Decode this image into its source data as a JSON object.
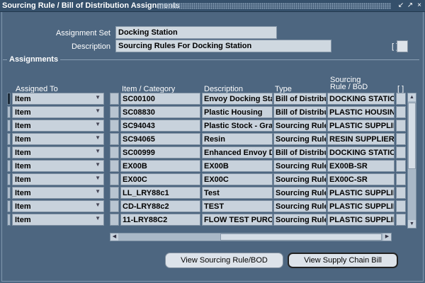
{
  "window": {
    "title": "Sourcing Rule / Bill of Distribution Assignments",
    "controls": [
      "↙",
      "↗",
      "×"
    ]
  },
  "header": {
    "assignment_set_label": "Assignment Set",
    "assignment_set_value": "Docking Station",
    "description_label": "Description",
    "description_value": "Sourcing Rules For Docking Station",
    "bracket": "[ ]"
  },
  "assignments": {
    "section_title": "Assignments",
    "columns": {
      "assigned_to": "Assigned To",
      "item_category": "Item / Category",
      "description": "Description",
      "type": "Type",
      "sourcing_rule_line1": "Sourcing",
      "sourcing_rule_line2": "Rule / BoD",
      "bracket": "[ ]"
    },
    "rows": [
      {
        "assigned_to": "Item",
        "item": "SC00100",
        "description": "Envoy Docking Station",
        "type": "Bill of Distribution",
        "rule": "DOCKING STATION"
      },
      {
        "assigned_to": "Item",
        "item": "SC08830",
        "description": "Plastic Housing",
        "type": "Bill of Distribution",
        "rule": "PLASTIC HOUSING"
      },
      {
        "assigned_to": "Item",
        "item": "SC94043",
        "description": "Plastic Stock - Gray",
        "type": "Sourcing Rule",
        "rule": "PLASTIC SUPPLIER"
      },
      {
        "assigned_to": "Item",
        "item": "SC94065",
        "description": "Resin",
        "type": "Sourcing Rule",
        "rule": "RESIN SUPPLIERS"
      },
      {
        "assigned_to": "Item",
        "item": "SC00999",
        "description": "Enhanced Envoy Docking",
        "type": "Bill of Distribution",
        "rule": "DOCKING STATION"
      },
      {
        "assigned_to": "Item",
        "item": "EX00B",
        "description": "EX00B",
        "type": "Sourcing Rule",
        "rule": "EX00B-SR"
      },
      {
        "assigned_to": "Item",
        "item": "EX00C",
        "description": "EX00C",
        "type": "Sourcing Rule",
        "rule": "EX00C-SR"
      },
      {
        "assigned_to": "Item",
        "item": "LL_LRY88c1",
        "description": "Test",
        "type": "Sourcing Rule",
        "rule": "PLASTIC SUPPLIER"
      },
      {
        "assigned_to": "Item",
        "item": "CD-LRY88c2",
        "description": "TEST",
        "type": "Sourcing Rule",
        "rule": "PLASTIC SUPPLIER"
      },
      {
        "assigned_to": "Item",
        "item": "11-LRY88C2",
        "description": "FLOW TEST PURCHASE",
        "type": "Sourcing Rule",
        "rule": "PLASTIC SUPPLIER"
      }
    ]
  },
  "buttons": {
    "view_sourcing_rule": "View Sourcing Rule/BOD",
    "view_supply_chain": "View Supply Chain Bill"
  },
  "icons": {
    "dropdown": "▼",
    "scroll_up": "▲",
    "scroll_down": "▼",
    "scroll_left": "◀",
    "scroll_right": "▶"
  }
}
